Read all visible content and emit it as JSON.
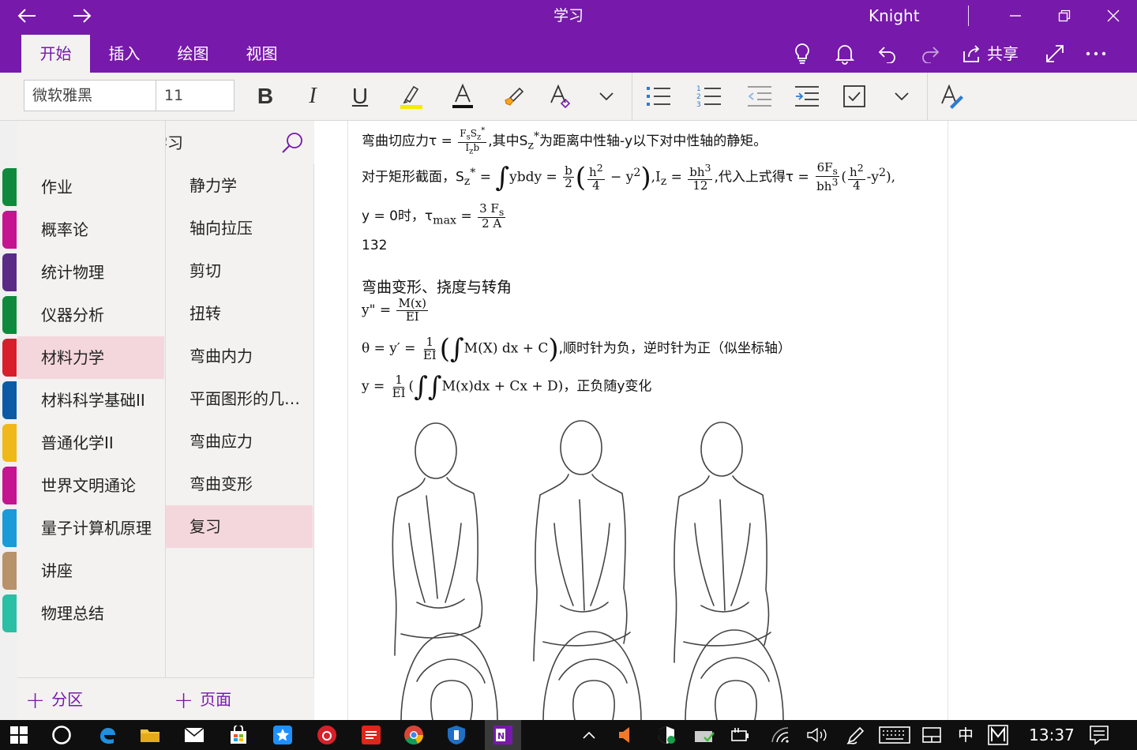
{
  "window": {
    "title": "学习",
    "user": "Knight"
  },
  "ribbon": {
    "tabs": [
      {
        "label": "开始"
      },
      {
        "label": "插入"
      },
      {
        "label": "绘图"
      },
      {
        "label": "视图"
      }
    ],
    "share_label": "共享"
  },
  "toolbar": {
    "font_name": "微软雅黑",
    "font_size": "11",
    "bold": "B",
    "italic": "I",
    "underline": "U"
  },
  "navigation": {
    "notebook_title": "学习",
    "sections": [
      {
        "label": "作业",
        "color": "#0f8a3c"
      },
      {
        "label": "概率论",
        "color": "#c4148f"
      },
      {
        "label": "统计物理",
        "color": "#5b2a86"
      },
      {
        "label": "仪器分析",
        "color": "#0f8a3c"
      },
      {
        "label": "材料力学",
        "color": "#d81e2b"
      },
      {
        "label": "材料科学基础II",
        "color": "#0c5aa6"
      },
      {
        "label": "普通化学II",
        "color": "#f0b81a"
      },
      {
        "label": "世界文明通论",
        "color": "#c4148f"
      },
      {
        "label": "量子计算机原理",
        "color": "#1a9ad6"
      },
      {
        "label": "讲座",
        "color": "#b8926a"
      },
      {
        "label": "物理总结",
        "color": "#2bbfa5"
      }
    ],
    "selected_section": "材料力学",
    "pages": [
      {
        "label": "静力学"
      },
      {
        "label": "轴向拉压"
      },
      {
        "label": "剪切"
      },
      {
        "label": "扭转"
      },
      {
        "label": "弯曲内力"
      },
      {
        "label": "平面图形的几…"
      },
      {
        "label": "弯曲应力"
      },
      {
        "label": "弯曲变形"
      },
      {
        "label": "复习"
      }
    ],
    "selected_page": "复习",
    "add_section_label": "分区",
    "add_page_label": "页面"
  },
  "note": {
    "l1_prefix": "弯曲切应力τ =",
    "l1_suffix": ",其中S",
    "l1_suffix2": "为距离中性轴-y以下对中性轴的静矩。",
    "l2_prefix": "对于矩形截面，S",
    "l2_ybdy": "ybdy =",
    "l2_iz": ",I",
    "l2_sub_z": "z",
    "l2_eq": "=",
    "l2_mid": ",代入上式得τ =",
    "l2_tail": "-y",
    "l2_end": "),",
    "l3_prefix": "y = 0时，τ",
    "l3_sub": "max",
    "l3_eq": "=",
    "l4": "132",
    "heading": "弯曲变形、挠度与转角",
    "l5_prefix": "y\" =",
    "l6_prefix": "θ = y′ =",
    "l6_integral": "M(X) dx + C",
    "l6_tail": ",顺时针为负，逆时针为正（似坐标轴）",
    "l7_prefix": "y =",
    "l7_integral": "M(x)dx + Cx + D)",
    "l7_tail": "，正负随y变化"
  },
  "taskbar": {
    "ime": "中",
    "time": "13:37"
  }
}
